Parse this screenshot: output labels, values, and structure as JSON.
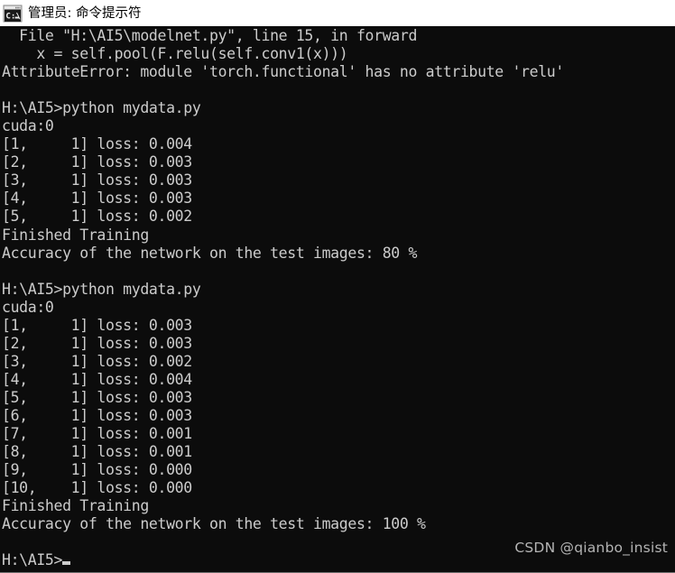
{
  "window": {
    "titlebar": {
      "icon": "cmd-console-icon",
      "title": "管理员: 命令提示符"
    },
    "background_color": "#0c0c0c",
    "text_color": "#cccccc",
    "titlebar_background": "#ffffff",
    "titlebar_text_color": "#000000"
  },
  "console": {
    "lines": [
      "  File \"H:\\AI5\\modelnet.py\", line 15, in forward",
      "    x = self.pool(F.relu(self.conv1(x)))",
      "AttributeError: module 'torch.functional' has no attribute 'relu'",
      "",
      "H:\\AI5>python mydata.py",
      "cuda:0",
      "[1,     1] loss: 0.004",
      "[2,     1] loss: 0.003",
      "[3,     1] loss: 0.003",
      "[4,     1] loss: 0.003",
      "[5,     1] loss: 0.002",
      "Finished Training",
      "Accuracy of the network on the test images: 80 %",
      "",
      "H:\\AI5>python mydata.py",
      "cuda:0",
      "[1,     1] loss: 0.003",
      "[2,     1] loss: 0.003",
      "[3,     1] loss: 0.002",
      "[4,     1] loss: 0.004",
      "[5,     1] loss: 0.003",
      "[6,     1] loss: 0.003",
      "[7,     1] loss: 0.001",
      "[8,     1] loss: 0.001",
      "[9,     1] loss: 0.000",
      "[10,    1] loss: 0.000",
      "Finished Training",
      "Accuracy of the network on the test images: 100 %",
      "",
      "H:\\AI5>"
    ],
    "traceback": {
      "file_line": "  File \"H:\\AI5\\modelnet.py\", line 15, in forward",
      "source_line": "    x = self.pool(F.relu(self.conv1(x)))",
      "error_line": "AttributeError: module 'torch.functional' has no attribute 'relu'",
      "error_type": "AttributeError",
      "file_path": "H:\\AI5\\modelnet.py",
      "line_number": "15",
      "function": "forward",
      "module": "torch.functional",
      "attribute": "relu"
    },
    "runs": [
      {
        "command": "H:\\AI5>python mydata.py",
        "device": "cuda:0",
        "epochs": [
          {
            "epoch": "1",
            "step": "1",
            "loss": "0.004"
          },
          {
            "epoch": "2",
            "step": "1",
            "loss": "0.003"
          },
          {
            "epoch": "3",
            "step": "1",
            "loss": "0.003"
          },
          {
            "epoch": "4",
            "step": "1",
            "loss": "0.003"
          },
          {
            "epoch": "5",
            "step": "1",
            "loss": "0.002"
          }
        ],
        "finished_text": "Finished Training",
        "accuracy_text": "Accuracy of the network on the test images: 80 %",
        "accuracy_value": "80 %"
      },
      {
        "command": "H:\\AI5>python mydata.py",
        "device": "cuda:0",
        "epochs": [
          {
            "epoch": "1",
            "step": "1",
            "loss": "0.003"
          },
          {
            "epoch": "2",
            "step": "1",
            "loss": "0.003"
          },
          {
            "epoch": "3",
            "step": "1",
            "loss": "0.002"
          },
          {
            "epoch": "4",
            "step": "1",
            "loss": "0.004"
          },
          {
            "epoch": "5",
            "step": "1",
            "loss": "0.003"
          },
          {
            "epoch": "6",
            "step": "1",
            "loss": "0.003"
          },
          {
            "epoch": "7",
            "step": "1",
            "loss": "0.001"
          },
          {
            "epoch": "8",
            "step": "1",
            "loss": "0.001"
          },
          {
            "epoch": "9",
            "step": "1",
            "loss": "0.000"
          },
          {
            "epoch": "10",
            "step": "1",
            "loss": "0.000"
          }
        ],
        "finished_text": "Finished Training",
        "accuracy_text": "Accuracy of the network on the test images: 100 %",
        "accuracy_value": "100 %"
      }
    ],
    "prompt": "H:\\AI5>",
    "cursor": "block-cursor"
  },
  "watermark": {
    "text": "CSDN @qianbo_insist"
  }
}
